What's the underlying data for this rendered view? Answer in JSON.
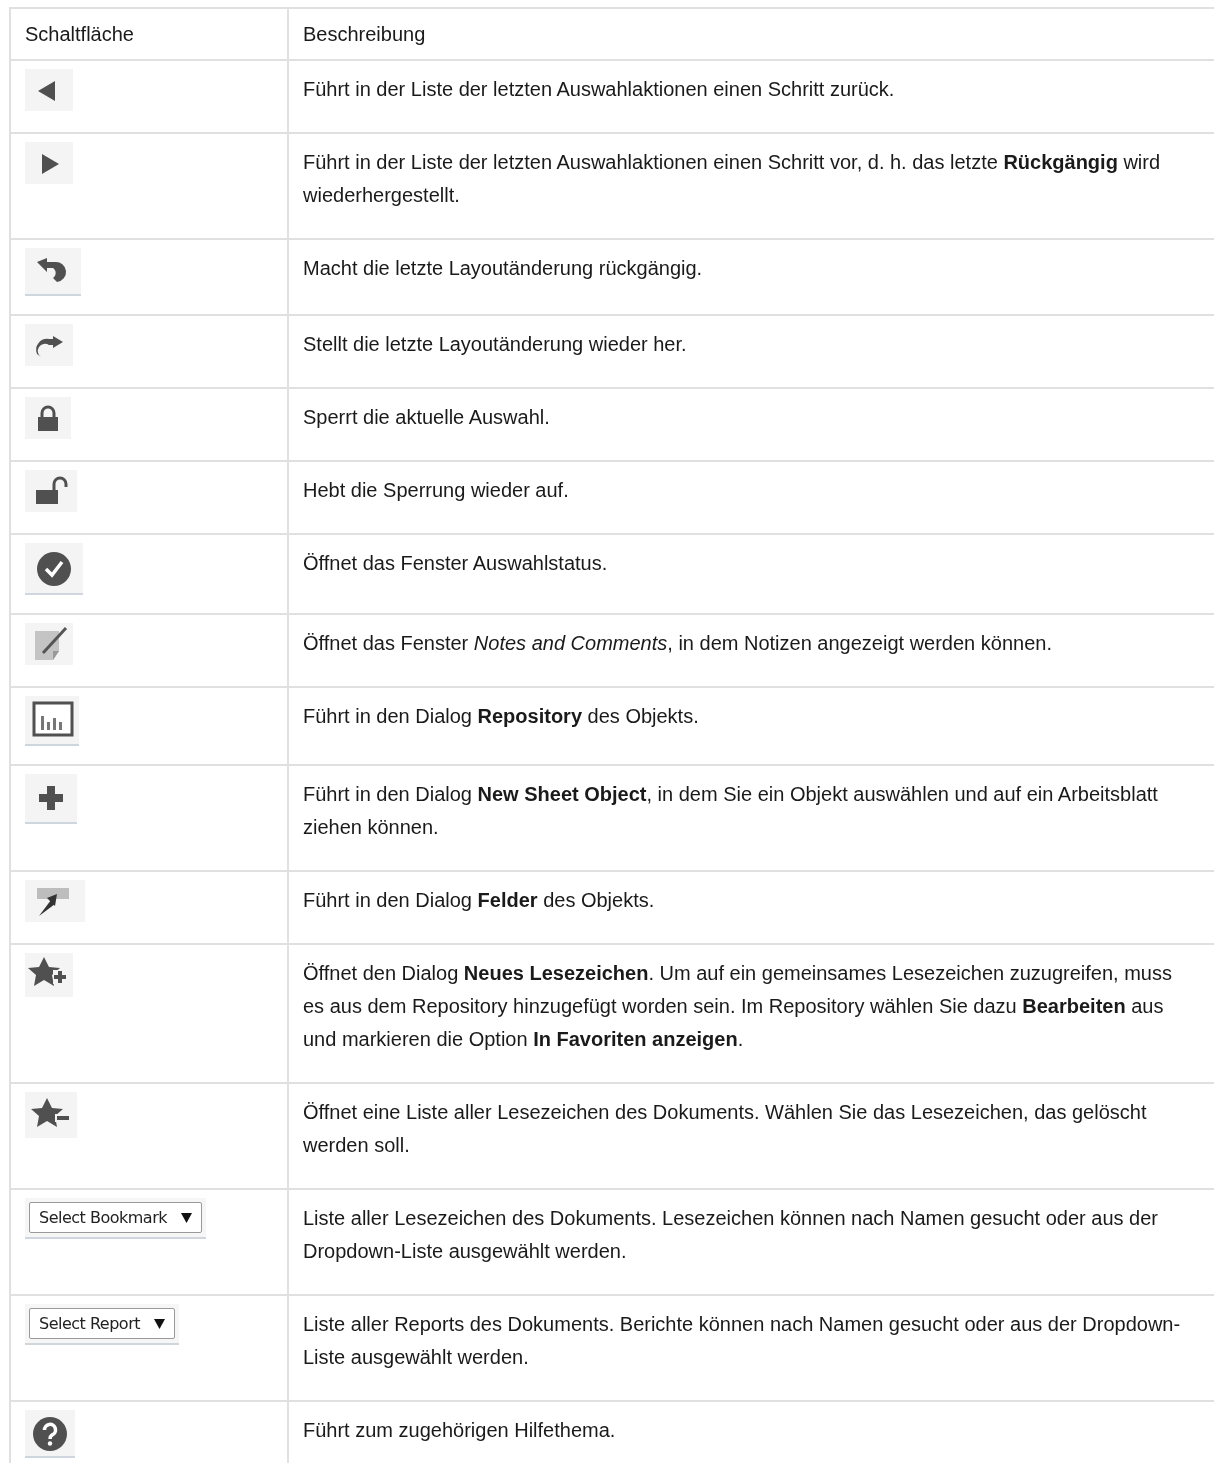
{
  "table": {
    "columns": [
      "Schaltfläche",
      "Beschreibung"
    ],
    "rows": [
      {
        "kind": "icon",
        "description": "Führt in der Liste der letzten Auswahlaktionen einen Schritt zurück."
      },
      {
        "kind": "icon",
        "description": "Führt in der Liste der letzten Auswahlaktionen einen Schritt vor, d. h. das letzte **Rückgängig** wird wiederhergestellt."
      },
      {
        "kind": "icon",
        "description": "Macht die letzte Layoutänderung rückgängig."
      },
      {
        "kind": "icon",
        "description": "Stellt die letzte Layoutänderung wieder her."
      },
      {
        "kind": "icon",
        "description": "Sperrt die aktuelle Auswahl."
      },
      {
        "kind": "icon",
        "description": "Hebt die Sperrung wieder auf."
      },
      {
        "kind": "icon",
        "description": "Öffnet das Fenster Auswahlstatus."
      },
      {
        "kind": "icon",
        "description": "Öffnet das Fenster *Notes and Comments*, in dem Notizen angezeigt werden können."
      },
      {
        "kind": "icon",
        "description": "Führt in den Dialog **Repository** des Objekts."
      },
      {
        "kind": "icon",
        "description": "Führt in den Dialog **New Sheet Object**, in dem Sie ein Objekt auswählen und auf ein Arbeitsblatt ziehen können."
      },
      {
        "kind": "icon",
        "description": "Führt in den Dialog **Felder** des Objekts."
      },
      {
        "kind": "icon",
        "description": "Öffnet den Dialog **Neues Lesezeichen**. Um auf ein gemeinsames Lesezeichen zuzugreifen, muss es aus dem Repository hinzugefügt worden sein. Im Repository wählen Sie dazu **Bearbeiten** aus und markieren die Option **In Favoriten anzeigen**."
      },
      {
        "kind": "icon",
        "description": "Öffnet eine Liste aller Lesezeichen des Dokuments. Wählen Sie das Lesezeichen, das gelöscht werden soll."
      },
      {
        "kind": "dropdown",
        "label": "Select Bookmark",
        "description": "Liste aller Lesezeichen des Dokuments. Lesezeichen können nach Namen gesucht oder aus der Dropdown-Liste ausgewählt werden."
      },
      {
        "kind": "dropdown",
        "label": "Select Report",
        "description": "Liste aller Reports des Dokuments. Berichte können nach Namen gesucht oder aus der Dropdown-Liste ausgewählt werden."
      },
      {
        "kind": "icon",
        "description": "Führt zum zugehörigen Hilfethema."
      }
    ]
  }
}
